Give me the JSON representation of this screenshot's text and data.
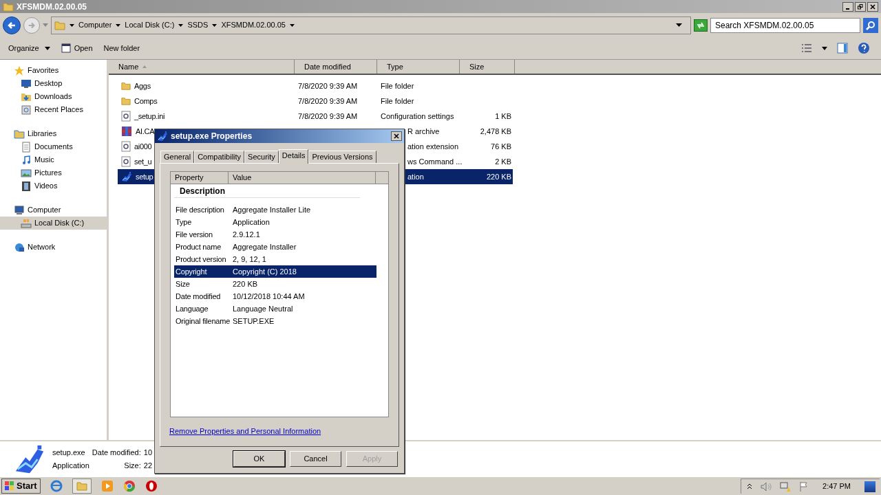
{
  "window": {
    "title": "XFSMDM.02.00.05"
  },
  "address": {
    "crumbs": [
      "Computer",
      "Local Disk (C:)",
      "SSDS",
      "XFSMDM.02.00.05"
    ]
  },
  "search": {
    "placeholder": "Search XFSMDM.02.00.05"
  },
  "toolbar": [
    "Organize",
    "Open",
    "New folder"
  ],
  "sidebar": {
    "groups": [
      {
        "label": "Favorites",
        "kind": "star",
        "children": [
          {
            "label": "Desktop",
            "kind": "desktop",
            "selected": false
          },
          {
            "label": "Downloads",
            "kind": "downloads",
            "selected": false
          },
          {
            "label": "Recent Places",
            "kind": "recent",
            "selected": false
          }
        ]
      },
      {
        "label": "Libraries",
        "kind": "libraries",
        "children": [
          {
            "label": "Documents",
            "kind": "document",
            "selected": false
          },
          {
            "label": "Music",
            "kind": "music",
            "selected": false
          },
          {
            "label": "Pictures",
            "kind": "pictures",
            "selected": false
          },
          {
            "label": "Videos",
            "kind": "videos",
            "selected": false
          }
        ]
      },
      {
        "label": "Computer",
        "kind": "computer",
        "children": [
          {
            "label": "Local Disk (C:)",
            "kind": "disk",
            "selected": true
          }
        ]
      },
      {
        "label": "Network",
        "kind": "network"
      }
    ]
  },
  "table": {
    "columns": [
      "Name",
      "Date modified",
      "Type",
      "Size"
    ],
    "rows": [
      {
        "kind": "folder",
        "name": "Aggs",
        "date": "7/8/2020 9:39 AM",
        "type": "File folder",
        "selected": false
      },
      {
        "kind": "folder",
        "name": "Comps",
        "date": "7/8/2020 9:39 AM",
        "type": "File folder",
        "selected": false
      },
      {
        "kind": "config",
        "name": "_setup.ini",
        "date": "7/8/2020 9:39 AM",
        "type": "Configuration settings",
        "size": "1 KB",
        "selected": false
      },
      {
        "kind": "archive",
        "name": "AI.CA",
        "type": "R archive",
        "size": "2,478 KB",
        "selected": false
      },
      {
        "kind": "config",
        "name": "ai000",
        "type": "ation extension",
        "size": "76 KB",
        "selected": false
      },
      {
        "kind": "config",
        "name": "set_u",
        "type": "ws Command ...",
        "size": "2 KB",
        "selected": false
      },
      {
        "kind": "app",
        "name": "setup",
        "type": "ation",
        "size": "220 KB",
        "selected": true
      }
    ]
  },
  "details_pane": {
    "name": "setup.exe",
    "type": "Application",
    "fields": [
      {
        "label": "Date modified:",
        "value": "10"
      },
      {
        "label": "Size:",
        "value": "22"
      }
    ]
  },
  "dialog": {
    "title": "setup.exe Properties",
    "tabs": [
      {
        "label": "General",
        "selected": false
      },
      {
        "label": "Compatibility",
        "selected": false
      },
      {
        "label": "Security",
        "selected": false
      },
      {
        "label": "Details",
        "selected": true
      },
      {
        "label": "Previous Versions",
        "selected": false
      }
    ],
    "columns": [
      "Property",
      "Value"
    ],
    "section": "Description",
    "properties": [
      {
        "name": "File description",
        "value": "Aggregate Installer Lite",
        "selected": false
      },
      {
        "name": "Type",
        "value": "Application",
        "selected": false
      },
      {
        "name": "File version",
        "value": "2.9.12.1",
        "selected": false
      },
      {
        "name": "Product name",
        "value": "Aggregate Installer",
        "selected": false
      },
      {
        "name": "Product version",
        "value": "2, 9, 12, 1",
        "selected": false
      },
      {
        "name": "Copyright",
        "value": "Copyright (C) 2018",
        "selected": true
      },
      {
        "name": "Size",
        "value": "220 KB",
        "selected": false
      },
      {
        "name": "Date modified",
        "value": "10/12/2018 10:44 AM",
        "selected": false
      },
      {
        "name": "Language",
        "value": "Language Neutral",
        "selected": false
      },
      {
        "name": "Original filename",
        "value": "SETUP.EXE",
        "selected": false
      }
    ],
    "link": "Remove Properties and Personal Information",
    "buttons": [
      {
        "label": "OK",
        "disabled": false
      },
      {
        "label": "Cancel",
        "disabled": false
      },
      {
        "label": "Apply",
        "disabled": true
      }
    ]
  },
  "taskbar": {
    "start": "Start",
    "clock": "2:47 PM"
  }
}
